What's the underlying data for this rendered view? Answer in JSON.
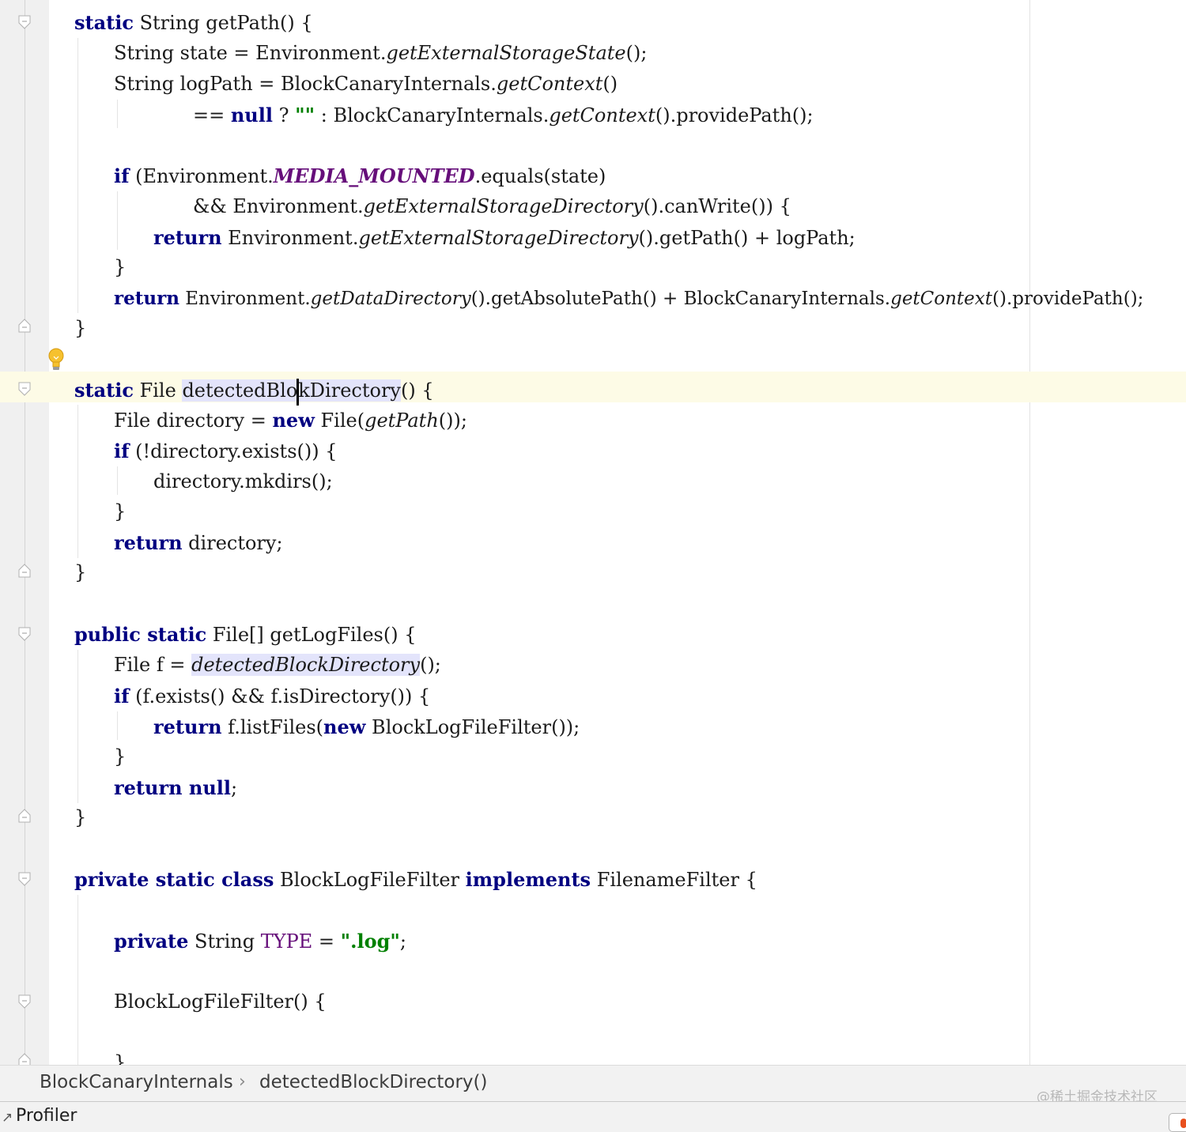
{
  "code": {
    "l1": {
      "k1": "static",
      "t1": " String getPath() {"
    },
    "l2": {
      "t1": "String state = Environment.",
      "i1": "getExternalStorageState",
      "t2": "();"
    },
    "l3": {
      "t1": "String logPath = BlockCanaryInternals.",
      "i1": "getContext",
      "t2": "()"
    },
    "l4": {
      "t1": "== ",
      "k1": "null",
      "t2": " ? ",
      "s1": "\"\"",
      "t3": " : BlockCanaryInternals.",
      "i1": "getContext",
      "t4": "().providePath();"
    },
    "l5": {
      "k1": "if",
      "t1": " (Environment.",
      "c1": "MEDIA_MOUNTED",
      "t2": ".equals(state)"
    },
    "l6": {
      "t1": "&& Environment.",
      "i1": "getExternalStorageDirectory",
      "t2": "().canWrite()) {"
    },
    "l7": {
      "k1": "return",
      "t1": " Environment.",
      "i1": "getExternalStorageDirectory",
      "t2": "().getPath() + logPath;"
    },
    "l8": {
      "t1": "}"
    },
    "l9": {
      "k1": "return",
      "t1": " Environment.",
      "i1": "getDataDirectory",
      "t2": "().getAbsolutePath() + BlockCanaryInternals.",
      "i2": "getContext",
      "t3": "().providePath();"
    },
    "l10": {
      "t1": "}"
    },
    "l11": {
      "k1": "static",
      "t1": " File ",
      "h1": "detectedBlo",
      "h2": "kDirectory",
      "t2": "() {"
    },
    "l12": {
      "t1": "File directory = ",
      "k1": "new",
      "t2": " File(",
      "i1": "getPath",
      "t3": "());"
    },
    "l13": {
      "k1": "if",
      "t1": " (!directory.exists()) {"
    },
    "l14": {
      "t1": "directory.mkdirs();"
    },
    "l15": {
      "t1": "}"
    },
    "l16": {
      "k1": "return",
      "t1": " directory;"
    },
    "l17": {
      "t1": "}"
    },
    "l18": {
      "k1": "public static",
      "t1": " File[] getLogFiles() {"
    },
    "l19": {
      "t1": "File f = ",
      "h1": "detectedBlockDirectory",
      "t2": "();"
    },
    "l20": {
      "k1": "if",
      "t1": " (f.exists() && f.isDirectory()) {"
    },
    "l21": {
      "k1": "return",
      "t1": " f.listFiles(",
      "k2": "new",
      "t2": " BlockLogFileFilter());"
    },
    "l22": {
      "t1": "}"
    },
    "l23": {
      "k1": "return null",
      "t1": ";"
    },
    "l24": {
      "t1": "}"
    },
    "l25": {
      "k1": "private static class",
      "t1": " BlockLogFileFilter ",
      "k2": "implements",
      "t2": " FilenameFilter {"
    },
    "l26": {
      "k1": "private",
      "t1": " String ",
      "f1": "TYPE",
      "t2": " = ",
      "s1": "\".log\"",
      "t3": ";"
    },
    "l27": {
      "t1": "BlockLogFileFilter() {"
    },
    "l28": {
      "t1": "}"
    }
  },
  "breadcrumb": {
    "class_name": "BlockCanaryInternals",
    "separator": "›",
    "method_name": "detectedBlockDirectory()"
  },
  "statusbar": {
    "profiler_label": "Profiler"
  },
  "watermark": "@稀土掘金技术社区",
  "icons": {
    "lightbulb": "intention-bulb-icon",
    "fold": "fold-marker-icon"
  },
  "colors": {
    "keyword": "#000080",
    "string": "#008000",
    "constant": "#660e7a",
    "caret_row": "#fdfbe6",
    "usage_highlight": "#e3e4fb"
  }
}
